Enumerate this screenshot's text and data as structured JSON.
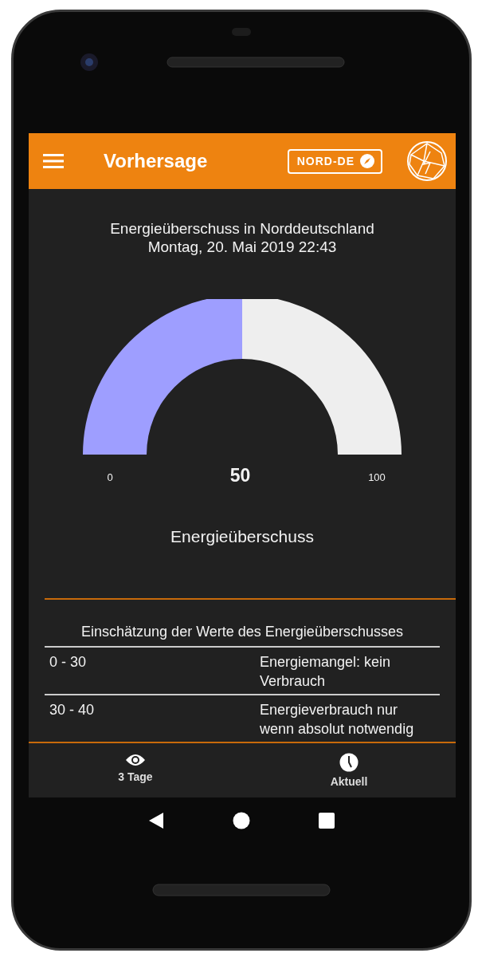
{
  "app_bar": {
    "title": "Vorhersage",
    "region_button": "NORD-DE"
  },
  "heading": {
    "title": "Energieüberschuss in Norddeutschland",
    "date": "Montag, 20. Mai 2019 22:43"
  },
  "gauge": {
    "level": 0.5,
    "min_label": "0",
    "max_label": "100",
    "value": "50",
    "caption": "Energieüberschuss"
  },
  "table": {
    "caption": "Einschätzung der Werte des Energieüberschusses",
    "rows": [
      {
        "range": "0 - 30",
        "meaning": "Energiemangel: kein Verbrauch"
      },
      {
        "range": "30 - 40",
        "meaning": "Energieverbrauch nur wenn absolut notwendig"
      }
    ]
  },
  "bottom_nav": [
    {
      "kind": "eye",
      "label": "3 Tage"
    },
    {
      "kind": "clock",
      "label": "Aktuell"
    }
  ]
}
